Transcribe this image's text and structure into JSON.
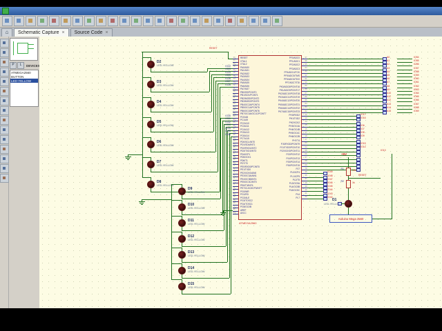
{
  "window": {
    "title": ""
  },
  "colors": {
    "wire_green": "#1d6f1d",
    "component_outline": "#b03030",
    "canvas_bg": "#fdfce4",
    "pin_blue": "#2e2e8f",
    "label_red": "#cc2222",
    "selection_blue": "#2a4f9e",
    "titlebar_blue": "#2d5a9e"
  },
  "tabs": [
    {
      "label": "Schematic Capture",
      "close": "×",
      "active": true
    },
    {
      "label": "Source Code",
      "close": "×",
      "active": false
    }
  ],
  "toolbar_icons": [
    "new-project",
    "open-project",
    "save-project",
    "import",
    "export",
    "print",
    "mark-area",
    "refresh",
    "grid-toggle",
    "false-origin",
    "center-at-cursor",
    "zoom-in",
    "zoom-out",
    "zoom-all",
    "zoom-area",
    "undo",
    "redo",
    "cut",
    "copy",
    "paste",
    "block-copy",
    "block-move",
    "block-rotate",
    "block-delete"
  ],
  "left_toolbar_icons": [
    "selection-mode",
    "component-mode",
    "junction-dot-mode",
    "wire-label-mode",
    "text-script-mode",
    "buses-mode",
    "subcircuit-mode",
    "terminals-mode",
    "device-pins-mode",
    "graph-mode",
    "tape-recorder-mode",
    "generator-mode",
    "voltage-probe-mode",
    "current-probe-mode",
    "virtual-instruments-mode"
  ],
  "panel": {
    "buttons": [
      "P",
      "L"
    ],
    "header": "DEVICES",
    "devices": [
      "ATMEGA2560",
      "BUTTON",
      "LED-YELLOW"
    ],
    "selected_device": "LED-YELLOW"
  },
  "schematic": {
    "leds_left": [
      [
        "D2",
        "LED-YELLOW"
      ],
      [
        "D3",
        "LED-YELLOW"
      ],
      [
        "D4",
        "LED-YELLOW"
      ],
      [
        "D5",
        "LED-YELLOW"
      ],
      [
        "D6",
        "LED-YELLOW"
      ],
      [
        "D7",
        "LED-YELLOW"
      ],
      [
        "D8",
        "LED-YELLOW"
      ]
    ],
    "leds_right": [
      [
        "D9",
        "LED-YELLOW"
      ],
      [
        "D10",
        "LED-YELLOW"
      ],
      [
        "D11",
        "LED-YELLOW"
      ],
      [
        "D12",
        "LED-YELLOW"
      ],
      [
        "D13",
        "LED-YELLOW"
      ],
      [
        "D14",
        "LED-YELLOW"
      ],
      [
        "D15",
        "LED-YELLOW"
      ]
    ],
    "ic": {
      "value": "ATMEGA2560",
      "left_pins": [
        [
          "30",
          "RESET"
        ],
        [
          "34",
          "XTAL1"
        ],
        [
          "33",
          "XTAL2"
        ],
        [
          "78",
          "PA0/AD0"
        ],
        [
          "77",
          "PA1/AD1"
        ],
        [
          "76",
          "PA2/AD2"
        ],
        [
          "75",
          "PA3/AD3"
        ],
        [
          "74",
          "PA4/AD4"
        ],
        [
          "73",
          "PA5/AD5"
        ],
        [
          "72",
          "PA6/AD6"
        ],
        [
          "71",
          "PA7/AD7"
        ],
        [
          "19",
          "PB0/SS/PCINT0"
        ],
        [
          "20",
          "PB1/SCK/PCINT1"
        ],
        [
          "21",
          "PB2/MOSI/PCINT2"
        ],
        [
          "22",
          "PB3/MISO/PCINT3"
        ],
        [
          "23",
          "PB4/OC2A/PCINT4"
        ],
        [
          "24",
          "PB5/OC1A/PCINT5"
        ],
        [
          "25",
          "PB6/OC1B/PCINT6"
        ],
        [
          "26",
          "PB7/OC0A/OC1C/PCINT7"
        ],
        [
          "53",
          "PC0/A8"
        ],
        [
          "54",
          "PC1/A9"
        ],
        [
          "55",
          "PC2/A10"
        ],
        [
          "56",
          "PC3/A11"
        ],
        [
          "57",
          "PC4/A12"
        ],
        [
          "58",
          "PC5/A13"
        ],
        [
          "59",
          "PC6/A14"
        ],
        [
          "60",
          "PC7/A15"
        ],
        [
          "43",
          "PD0/SCL/INT0"
        ],
        [
          "44",
          "PD1/SDA/INT1"
        ],
        [
          "45",
          "PD2/RXD1/INT2"
        ],
        [
          "46",
          "PD3/TXD1/INT3"
        ],
        [
          "47",
          "PD4/ICP1"
        ],
        [
          "48",
          "PD5/XCK1"
        ],
        [
          "49",
          "PD6/T1"
        ],
        [
          "50",
          "PD7/T0"
        ],
        [
          "2",
          "PE0/RXD0/PCINT8"
        ],
        [
          "3",
          "PE1/TXD0"
        ],
        [
          "4",
          "PE2/XCK0/AIN0"
        ],
        [
          "5",
          "PE3/OC3A/AIN1"
        ],
        [
          "6",
          "PE4/OC3B/INT4"
        ],
        [
          "7",
          "PE5/OC3C/INT5"
        ],
        [
          "8",
          "PE6/T3/INT6"
        ],
        [
          "9",
          "PE7/CLKO/ICP3/INT7"
        ],
        [
          "51",
          "PG0/WR"
        ],
        [
          "52",
          "PG1/RD"
        ],
        [
          "70",
          "PG2/ALE"
        ],
        [
          "28",
          "PG3/TOSC2"
        ],
        [
          "29",
          "PG4/TOSC1"
        ],
        [
          "1",
          "PG5/OC0B"
        ],
        [
          "98",
          "AREF"
        ],
        [
          "100",
          "AVCC"
        ]
      ],
      "right_pins": [
        [
          "97",
          "PF0/ADC0"
        ],
        [
          "96",
          "PF1/ADC1"
        ],
        [
          "95",
          "PF2/ADC2"
        ],
        [
          "94",
          "PF3/ADC3"
        ],
        [
          "93",
          "PF4/ADC4/TCK"
        ],
        [
          "92",
          "PF5/ADC5/TMS"
        ],
        [
          "91",
          "PF6/ADC6/TDO"
        ],
        [
          "90",
          "PF7/ADC7/TDI"
        ],
        [
          "89",
          "PK0/ADC8/PCINT16"
        ],
        [
          "88",
          "PK1/ADC9/PCINT17"
        ],
        [
          "87",
          "PK2/ADC10/PCINT18"
        ],
        [
          "86",
          "PK3/ADC11/PCINT19"
        ],
        [
          "85",
          "PK4/ADC12/PCINT20"
        ],
        [
          "84",
          "PK5/ADC13/PCINT21"
        ],
        [
          "83",
          "PK6/ADC14/PCINT22"
        ],
        [
          "82",
          "PK7/ADC15/PCINT23"
        ],
        [
          "12",
          "PH0/RXD2"
        ],
        [
          "13",
          "PH1/TXD2"
        ],
        [
          "14",
          "PH2/XCK2"
        ],
        [
          "15",
          "PH3/OC4A"
        ],
        [
          "16",
          "PH4/OC4B"
        ],
        [
          "17",
          "PH5/OC4C"
        ],
        [
          "18",
          "PH6/OC2B"
        ],
        [
          "27",
          "PH7/T4"
        ],
        [
          "63",
          "PJ0/RXD3/PCINT9"
        ],
        [
          "64",
          "PJ1/TXD3/PCINT10"
        ],
        [
          "65",
          "PJ2/XCK3/PCINT11"
        ],
        [
          "66",
          "PJ3/PCINT12"
        ],
        [
          "67",
          "PJ4/PCINT13"
        ],
        [
          "68",
          "PJ5/PCINT14"
        ],
        [
          "69",
          "PJ6/PCINT15"
        ],
        [
          "79",
          "PJ7"
        ],
        [
          "35",
          "PL0/ICP4"
        ],
        [
          "36",
          "PL1/ICP5"
        ],
        [
          "37",
          "PL2/T5"
        ],
        [
          "38",
          "PL3/OC5A"
        ],
        [
          "39",
          "PL4/OC5B"
        ],
        [
          "40",
          "PL5/OC5C"
        ],
        [
          "41",
          "PL6"
        ],
        [
          "42",
          "PL7"
        ]
      ]
    },
    "left_labels_a": [
      "IO22",
      "IO23",
      "IO24",
      "IO25",
      "IO26",
      "IO27",
      "IO28"
    ],
    "left_labels_b": [
      "IO30",
      "IO31",
      "IO32",
      "IO33",
      "IO34",
      "IO35",
      "IO36"
    ],
    "right_far_pairs": [
      [
        "A0",
        "IO54"
      ],
      [
        "A1",
        "IO55"
      ],
      [
        "A2",
        "IO56"
      ],
      [
        "A3",
        "IO57"
      ],
      [
        "A4",
        "IO58"
      ],
      [
        "A5",
        "IO59"
      ],
      [
        "A6",
        "IO60"
      ],
      [
        "A7",
        "IO61"
      ],
      [
        "A8",
        "IO62"
      ],
      [
        "A9",
        "IO63"
      ],
      [
        "A10",
        "IO64"
      ],
      [
        "A11",
        "IO65"
      ],
      [
        "A12",
        "IO66"
      ],
      [
        "A13",
        "IO67"
      ],
      [
        "A14",
        "IO68"
      ],
      [
        "A15",
        "IO69"
      ]
    ],
    "right_mid_labels": [
      "IO17",
      "IO16",
      "",
      "IO6",
      "IO7",
      "IO8",
      "IO9",
      "",
      "IO15",
      "IO14",
      "",
      "",
      "",
      "",
      "",
      ""
    ],
    "right_low_labels": [
      "IO49",
      "IO48",
      "IO47",
      "IO46",
      "IO45",
      "IO44",
      "IO43",
      "IO42"
    ],
    "annotations": {
      "reset_top": "RESET",
      "vcc": "+5V",
      "reset_right": "RESET",
      "io13": "IO13",
      "board": "Arduino Mega 2560"
    },
    "r1": {
      "ref": "R1",
      "value": "10k"
    },
    "r2": {
      "ref": "R2",
      "value": "1k"
    },
    "d1": {
      "ref": "D1",
      "value": "LED-YELLOW"
    }
  }
}
